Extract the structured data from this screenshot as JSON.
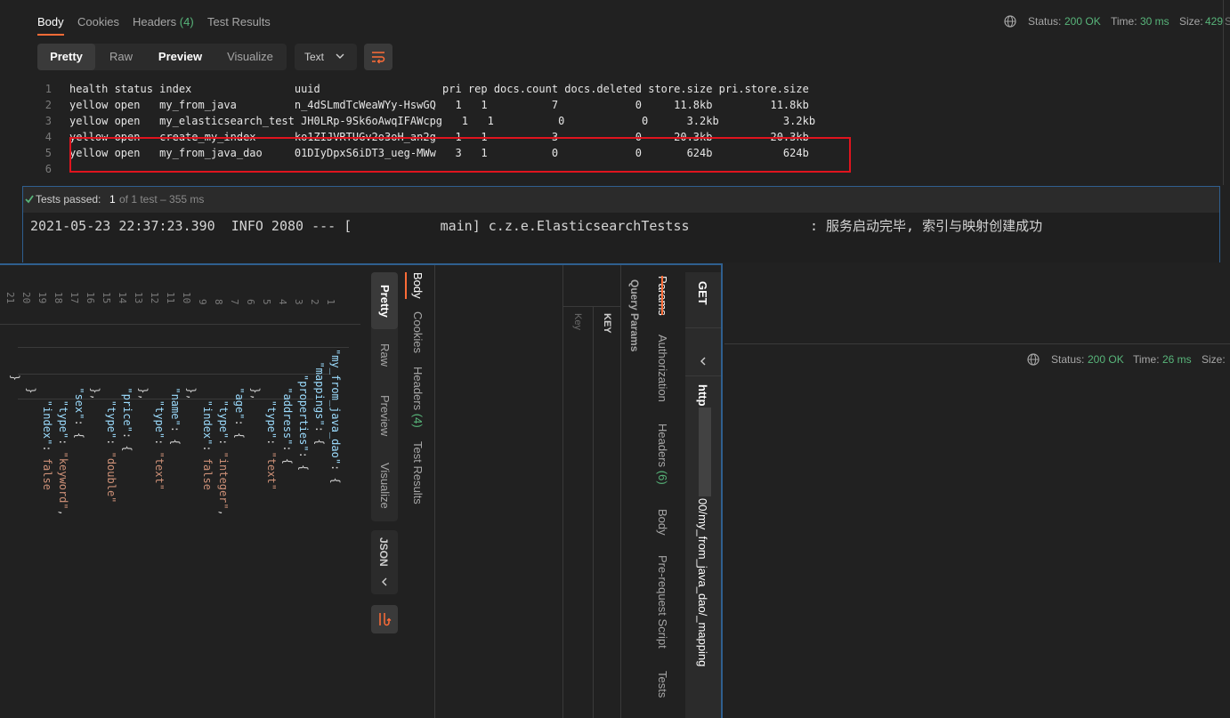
{
  "top": {
    "tabs": [
      {
        "label": "Body"
      },
      {
        "label": "Cookies"
      },
      {
        "label": "Headers",
        "count": "(4)"
      },
      {
        "label": "Test Results"
      }
    ],
    "status_label": "Status:",
    "status_value": "200 OK",
    "time_label": "Time:",
    "time_value": "30 ms",
    "size_label": "Size:",
    "size_value": "429",
    "edge_text": "S",
    "view_modes": [
      "Pretty",
      "Raw",
      "Preview",
      "Visualize"
    ],
    "format": "Text",
    "lines": [
      {
        "n": "1",
        "text": "health status index                uuid                   pri rep docs.count docs.deleted store.size pri.store.size"
      },
      {
        "n": "2",
        "text": "yellow open   my_from_java         n_4dSLmdTcWeaWYy-HswGQ   1   1          7            0     11.8kb         11.8kb"
      },
      {
        "n": "3",
        "text": "yellow open   my_elasticsearch_test JH0LRp-9Sk6oAwqIFAWcpg   1   1          0            0      3.2kb          3.2kb"
      },
      {
        "n": "4",
        "text": "yellow open   create_my_index      ko1ZIJVRTUGv2o3oH_an2g   1   1          3            0     20.3kb         20.3kb"
      },
      {
        "n": "5",
        "text": "yellow open   my_from_java_dao     01DIyDpxS6iDT3_ueg-MWw   3   1          0            0       624b           624b"
      },
      {
        "n": "6",
        "text": ""
      }
    ]
  },
  "console": {
    "tests_passed_label": "Tests passed:",
    "tests_passed_value": "1",
    "tests_detail": "of 1 test – 355 ms",
    "log": "2021-05-23 22:37:23.390  INFO 2080 --- [           main] c.z.e.ElasticsearchTestss               : 服务启动完毕, 索引与映射创建成功"
  },
  "bottom": {
    "method": "GET",
    "url": "http",
    "url_tail": "00/my_from_java_dao/_mapping",
    "request_tabs": [
      "Params",
      "Authorization",
      "Headers",
      "Body",
      "Pre-request Script",
      "Tests"
    ],
    "headers_count": "(6)",
    "query_params_label": "Query Params",
    "key_header": "KEY",
    "key_placeholder": "Key",
    "response_tabs": [
      "Body",
      "Cookies",
      "Headers",
      "Test Results"
    ],
    "response_headers_count": "(4)",
    "view_modes": [
      "Pretty",
      "Raw",
      "Preview",
      "Visualize"
    ],
    "format": "JSON",
    "status_label": "Status:",
    "status_value": "200 OK",
    "time_label": "Time:",
    "time_value": "26 ms",
    "size_label": "Size:",
    "line_numbers": [
      "1",
      "2",
      "3",
      "4",
      "5",
      "6",
      "7",
      "8",
      "9",
      "10",
      "11",
      "12",
      "13",
      "14",
      "15",
      "16",
      "17",
      "18",
      "19",
      "20",
      "21"
    ],
    "json_lines": [
      {
        "parts": [
          {
            "t": "k",
            "v": "\"my_from_java_dao\""
          },
          {
            "t": "p",
            "v": ": {"
          }
        ]
      },
      {
        "parts": [
          {
            "t": "k",
            "v": "  \"mappings\""
          },
          {
            "t": "p",
            "v": ": {"
          }
        ]
      },
      {
        "parts": [
          {
            "t": "k",
            "v": "    \"properties\""
          },
          {
            "t": "p",
            "v": ": {"
          }
        ]
      },
      {
        "parts": [
          {
            "t": "k",
            "v": "      \"address\""
          },
          {
            "t": "p",
            "v": ": {"
          }
        ]
      },
      {
        "parts": [
          {
            "t": "k",
            "v": "        \"type\""
          },
          {
            "t": "p",
            "v": ": "
          },
          {
            "t": "s",
            "v": "\"text\""
          }
        ]
      },
      {
        "parts": [
          {
            "t": "p",
            "v": "      },"
          }
        ]
      },
      {
        "parts": [
          {
            "t": "k",
            "v": "      \"age\""
          },
          {
            "t": "p",
            "v": ": {"
          }
        ]
      },
      {
        "parts": [
          {
            "t": "k",
            "v": "        \"type\""
          },
          {
            "t": "p",
            "v": ": "
          },
          {
            "t": "s",
            "v": "\"integer\""
          },
          {
            "t": "p",
            "v": ","
          }
        ]
      },
      {
        "parts": [
          {
            "t": "k",
            "v": "        \"index\""
          },
          {
            "t": "p",
            "v": ": "
          },
          {
            "t": "b",
            "v": "false"
          }
        ]
      },
      {
        "parts": [
          {
            "t": "p",
            "v": "      },"
          }
        ]
      },
      {
        "parts": [
          {
            "t": "k",
            "v": "      \"name\""
          },
          {
            "t": "p",
            "v": ": {"
          }
        ]
      },
      {
        "parts": [
          {
            "t": "k",
            "v": "        \"type\""
          },
          {
            "t": "p",
            "v": ": "
          },
          {
            "t": "s",
            "v": "\"text\""
          }
        ]
      },
      {
        "parts": [
          {
            "t": "p",
            "v": "      },"
          }
        ]
      },
      {
        "parts": [
          {
            "t": "k",
            "v": "      \"price\""
          },
          {
            "t": "p",
            "v": ": {"
          }
        ]
      },
      {
        "parts": [
          {
            "t": "k",
            "v": "        \"type\""
          },
          {
            "t": "p",
            "v": ": "
          },
          {
            "t": "s",
            "v": "\"double\""
          }
        ]
      },
      {
        "parts": [
          {
            "t": "p",
            "v": "      },"
          }
        ]
      },
      {
        "parts": [
          {
            "t": "k",
            "v": "      \"sex\""
          },
          {
            "t": "p",
            "v": ": {"
          }
        ]
      },
      {
        "parts": [
          {
            "t": "k",
            "v": "        \"type\""
          },
          {
            "t": "p",
            "v": ": "
          },
          {
            "t": "s",
            "v": "\"keyword\""
          },
          {
            "t": "p",
            "v": ","
          }
        ]
      },
      {
        "parts": [
          {
            "t": "k",
            "v": "        \"index\""
          },
          {
            "t": "p",
            "v": ": "
          },
          {
            "t": "b",
            "v": "false"
          }
        ]
      },
      {
        "parts": [
          {
            "t": "p",
            "v": "      }"
          }
        ]
      },
      {
        "parts": [
          {
            "t": "p",
            "v": "    }"
          }
        ]
      }
    ]
  },
  "colors": {
    "accent": "#ff6c37",
    "status_green": "#58b57a",
    "highlight_red": "#e0141e",
    "frame_blue": "#2f5f8f",
    "json_key": "#9cdcfe",
    "json_string": "#ce9178"
  }
}
